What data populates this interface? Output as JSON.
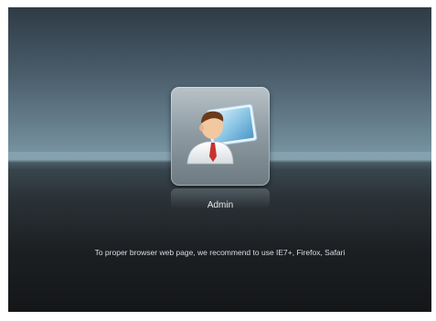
{
  "login": {
    "user_icon": "user-avatar-with-monitor-icon",
    "user_name": "Admin",
    "browser_note": "To proper browser web page, we recommend to use IE7+, Firefox, Safari"
  },
  "colors": {
    "sky_top": "#2f3b45",
    "horizon": "#7c99a7",
    "floor": "#141618",
    "tile": "#8f9ca4",
    "text": "#d8dde0"
  }
}
